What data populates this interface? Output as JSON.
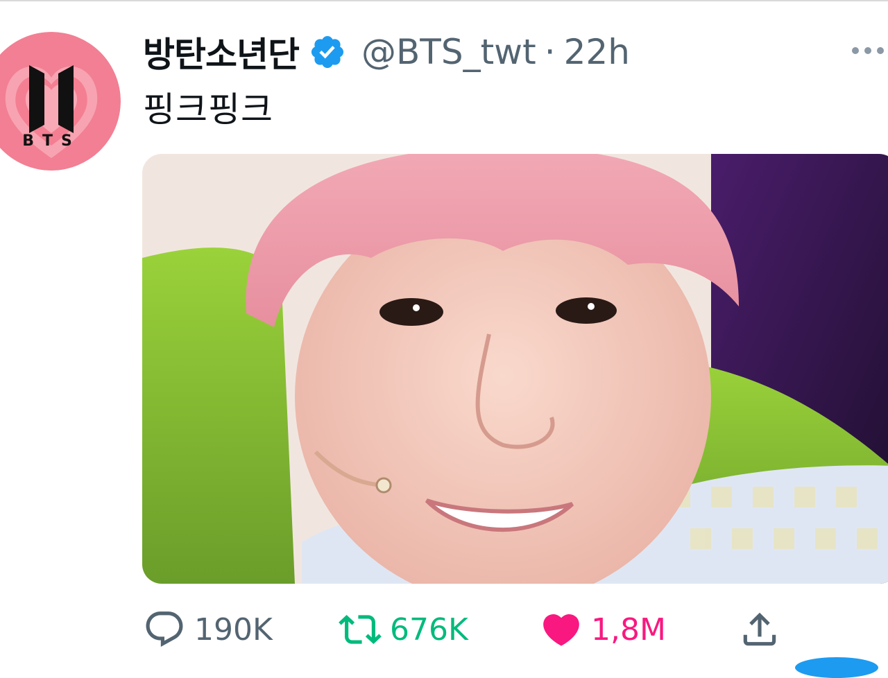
{
  "tweet": {
    "display_name": "방탄소년단",
    "verified": true,
    "handle": "@BTS_twt",
    "separator": "·",
    "time": "22h",
    "text": "핑크핑크",
    "avatar_text": "BTS"
  },
  "media": {
    "alt": ""
  },
  "actions": {
    "reply_count": "190K",
    "retweet_count": "676K",
    "like_count": "1,8M",
    "liked": true
  },
  "icons": {
    "more": "more-dots-icon",
    "verified": "verified-badge-icon",
    "reply": "reply-bubble-icon",
    "retweet": "retweet-arrows-icon",
    "like": "heart-icon",
    "share": "share-upload-icon"
  },
  "colors": {
    "verified_blue": "#1d9bf0",
    "retweet_green": "#00ba7c",
    "like_pink": "#f91880",
    "secondary_text": "#536471"
  }
}
